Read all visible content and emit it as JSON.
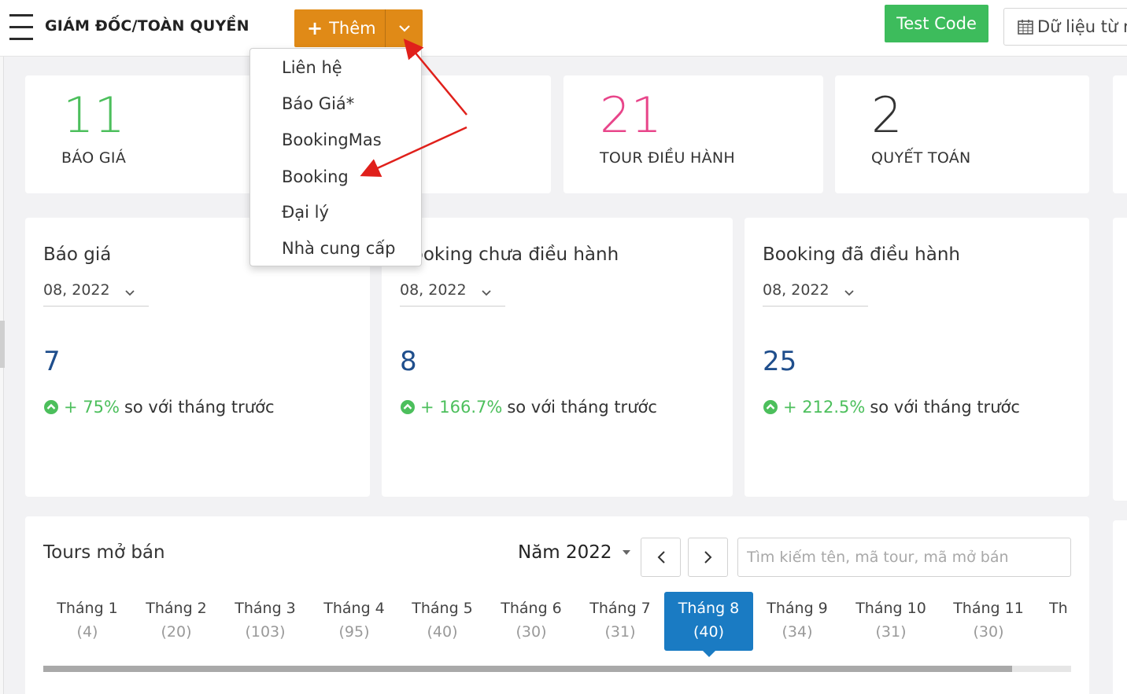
{
  "header": {
    "role_title": "GIÁM ĐỐC/TOÀN QUYỀN",
    "add_button": "Thêm",
    "test_button": "Test Code",
    "date_filter": "Dữ liệu từ n"
  },
  "add_menu": {
    "items": [
      {
        "label": "Liên hệ"
      },
      {
        "label": "Báo Giá*"
      },
      {
        "label": "BookingMas"
      },
      {
        "label": "Booking"
      },
      {
        "label": "Đại lý"
      },
      {
        "label": "Nhà cung cấp"
      }
    ]
  },
  "stats": [
    {
      "value": "11",
      "label": "BÁO GIÁ",
      "color": "#4cbf5c"
    },
    {
      "value": "21",
      "label": "TOUR ĐIỀU HÀNH",
      "color": "#e8458a"
    },
    {
      "value": "2",
      "label": "QUYẾT TOÁN",
      "color": "#333333"
    }
  ],
  "summary_cards": [
    {
      "title": "Báo giá",
      "month": "08, 2022",
      "value": "7",
      "growth": "+ 75%",
      "compare_text": "so với tháng trước"
    },
    {
      "title": "Booking chưa điều hành",
      "month": "08, 2022",
      "value": "8",
      "growth": "+ 166.7%",
      "compare_text": "so với tháng trước"
    },
    {
      "title": "Booking đã điều hành",
      "month": "08, 2022",
      "value": "25",
      "growth": "+ 212.5%",
      "compare_text": "so với tháng trước"
    }
  ],
  "tours": {
    "title": "Tours mở bán",
    "year": "Năm 2022",
    "search_placeholder": "Tìm kiếm tên, mã tour, mã mở bán",
    "months": [
      {
        "label": "Tháng 1",
        "count": "(4)"
      },
      {
        "label": "Tháng 2",
        "count": "(20)"
      },
      {
        "label": "Tháng 3",
        "count": "(103)"
      },
      {
        "label": "Tháng 4",
        "count": "(95)"
      },
      {
        "label": "Tháng 5",
        "count": "(40)"
      },
      {
        "label": "Tháng 6",
        "count": "(30)"
      },
      {
        "label": "Tháng 7",
        "count": "(31)"
      },
      {
        "label": "Tháng 8",
        "count": "(40)"
      },
      {
        "label": "Tháng 9",
        "count": "(34)"
      },
      {
        "label": "Tháng 10",
        "count": "(31)"
      },
      {
        "label": "Tháng 11",
        "count": "(30)"
      },
      {
        "label": "Th",
        "count": ""
      }
    ],
    "active_month": "Tháng 8"
  },
  "colors": {
    "accent_orange": "#e08a17",
    "accent_green": "#3dbc5c",
    "active_tab_blue": "#1a7bc3",
    "annotation_arrow": "#e0201b"
  }
}
